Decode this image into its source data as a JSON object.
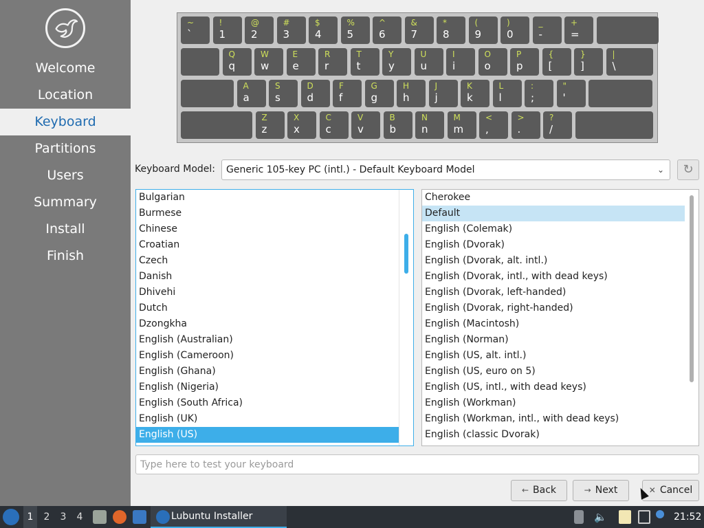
{
  "sidebar": {
    "steps": [
      "Welcome",
      "Location",
      "Keyboard",
      "Partitions",
      "Users",
      "Summary",
      "Install",
      "Finish"
    ],
    "active_index": 2
  },
  "keyboard": {
    "rows": [
      [
        [
          "~",
          "`"
        ],
        [
          "!",
          "1"
        ],
        [
          "@",
          "2"
        ],
        [
          "#",
          "3"
        ],
        [
          "$",
          "4"
        ],
        [
          "%",
          "5"
        ],
        [
          "^",
          "6"
        ],
        [
          "&",
          "7"
        ],
        [
          "*",
          "8"
        ],
        [
          "(",
          "9"
        ],
        [
          ")",
          "0"
        ],
        [
          "_",
          "-"
        ],
        [
          "+",
          "="
        ],
        [
          "",
          ""
        ]
      ],
      [
        [
          "",
          ""
        ],
        [
          "Q",
          "q"
        ],
        [
          "W",
          "w"
        ],
        [
          "E",
          "e"
        ],
        [
          "R",
          "r"
        ],
        [
          "T",
          "t"
        ],
        [
          "Y",
          "y"
        ],
        [
          "U",
          "u"
        ],
        [
          "I",
          "i"
        ],
        [
          "O",
          "o"
        ],
        [
          "P",
          "p"
        ],
        [
          "{",
          "["
        ],
        [
          "}",
          "]"
        ],
        [
          "|",
          "\\"
        ]
      ],
      [
        [
          "",
          ""
        ],
        [
          "A",
          "a"
        ],
        [
          "S",
          "s"
        ],
        [
          "D",
          "d"
        ],
        [
          "F",
          "f"
        ],
        [
          "G",
          "g"
        ],
        [
          "H",
          "h"
        ],
        [
          "J",
          "j"
        ],
        [
          "K",
          "k"
        ],
        [
          "L",
          "l"
        ],
        [
          ":",
          ";"
        ],
        [
          "\"",
          "'"
        ],
        [
          "",
          ""
        ]
      ],
      [
        [
          "",
          ""
        ],
        [
          "Z",
          "z"
        ],
        [
          "X",
          "x"
        ],
        [
          "C",
          "c"
        ],
        [
          "V",
          "v"
        ],
        [
          "B",
          "b"
        ],
        [
          "N",
          "n"
        ],
        [
          "M",
          "m"
        ],
        [
          "<",
          ","
        ],
        [
          ">",
          "."
        ],
        [
          "?",
          "/"
        ],
        [
          "",
          ""
        ]
      ]
    ]
  },
  "model": {
    "label": "Keyboard Model:",
    "value": "Generic 105-key PC (intl.)  -  Default Keyboard Model"
  },
  "layouts": [
    "Bulgarian",
    "Burmese",
    "Chinese",
    "Croatian",
    "Czech",
    "Danish",
    "Dhivehi",
    "Dutch",
    "Dzongkha",
    "English (Australian)",
    "English (Cameroon)",
    "English (Ghana)",
    "English (Nigeria)",
    "English (South Africa)",
    "English (UK)",
    "English (US)"
  ],
  "layouts_selected": 15,
  "variants": [
    "Cherokee",
    "Default",
    "English (Colemak)",
    "English (Dvorak)",
    "English (Dvorak, alt. intl.)",
    "English (Dvorak, intl., with dead keys)",
    "English (Dvorak, left-handed)",
    "English (Dvorak, right-handed)",
    "English (Macintosh)",
    "English (Norman)",
    "English (US, alt. intl.)",
    "English (US, euro on 5)",
    "English (US, intl., with dead keys)",
    "English (Workman)",
    "English (Workman, intl., with dead keys)",
    "English (classic Dvorak)"
  ],
  "variants_selected": 1,
  "test_input": {
    "placeholder": "Type here to test your keyboard"
  },
  "buttons": {
    "back": "Back",
    "next": "Next",
    "cancel": "Cancel"
  },
  "taskbar": {
    "workspaces": [
      "1",
      "2",
      "3",
      "4"
    ],
    "current_workspace": 0,
    "task_label": "Lubuntu Installer",
    "clock": "21:52"
  }
}
